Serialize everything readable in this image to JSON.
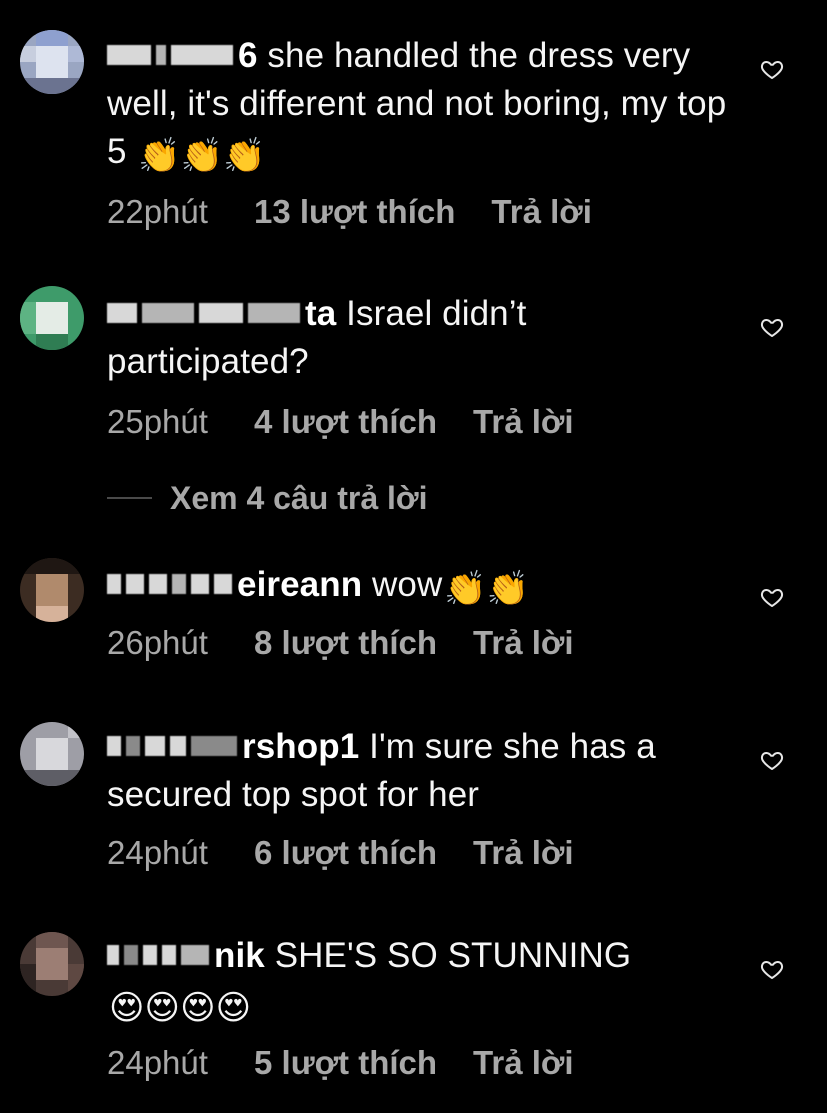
{
  "comments": [
    {
      "username_tail": "6",
      "text": "she handled the dress very well, it's different and not boring, my top 5",
      "emojis": "👏👏👏",
      "time": "22phút",
      "likes": "13 lượt thích",
      "reply": "Trả lời"
    },
    {
      "username_tail": "ta",
      "text": "Israel didn’t participated?",
      "emojis": "",
      "time": "25phút",
      "likes": "4 lượt thích",
      "reply": "Trả lời"
    },
    {
      "username_tail": "eireann",
      "text": "wow",
      "emojis": "👏👏",
      "time": "26phút",
      "likes": "8 lượt thích",
      "reply": "Trả lời"
    },
    {
      "username_tail": "rshop1",
      "text": "I'm sure she has a secured top spot for her",
      "emojis": "",
      "time": "24phút",
      "likes": "6 lượt thích",
      "reply": "Trả lời"
    },
    {
      "username_tail": "nik",
      "text": "SHE'S SO STUNNING",
      "emojis": "😍😍😍😍",
      "time": "24phút",
      "likes": "5 lượt thích",
      "reply": "Trả lời"
    }
  ],
  "view_replies": "Xem 4 câu trả lời",
  "icons": {
    "like": "heart-outline-icon"
  },
  "colors": {
    "background": "#000000",
    "text": "#f5f5f5",
    "secondary": "#a8a8a8"
  }
}
